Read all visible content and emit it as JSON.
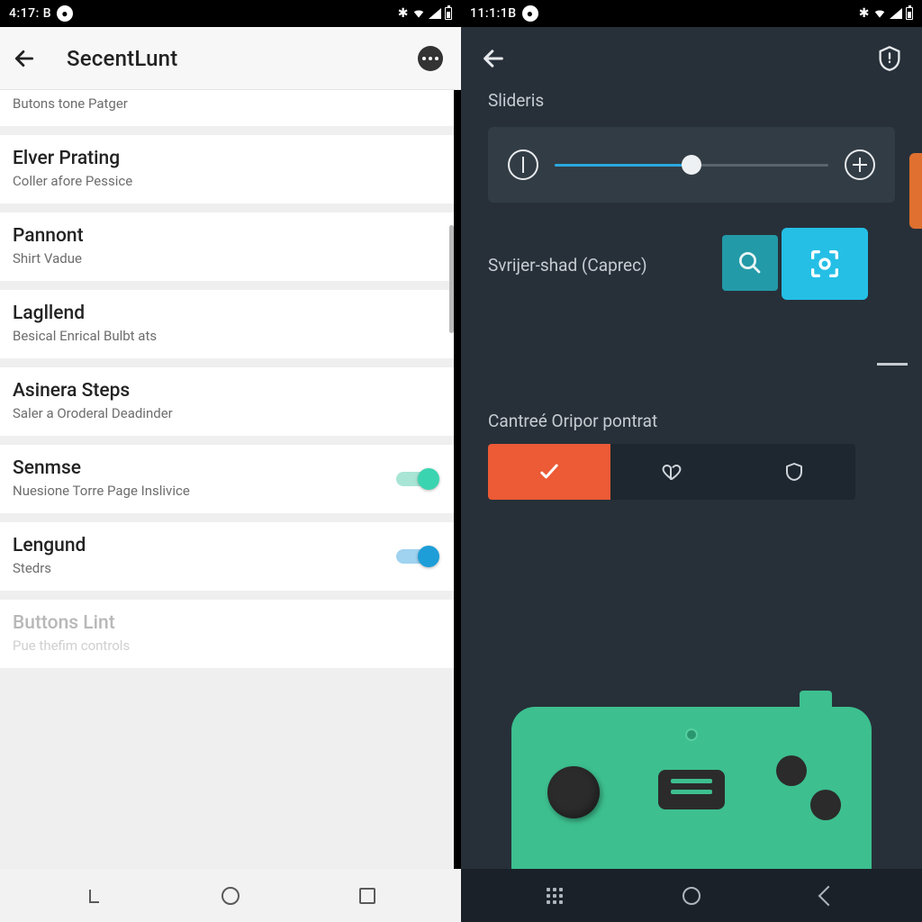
{
  "colors": {
    "accent_teal": "#3bd4b0",
    "accent_blue": "#1e9ed8",
    "dark_bg": "#273039",
    "orange": "#ec5a36",
    "green": "#3dbf8f",
    "cyan": "#25bfe6"
  },
  "left": {
    "status_time": "4:17: B",
    "title": "SecentLunt",
    "rows": [
      {
        "title": "",
        "subtitle": "Butons tone Patger"
      },
      {
        "title": "Elver Prating",
        "subtitle": "Coller afore Pessice"
      },
      {
        "title": "Pannont",
        "subtitle": "Shirt Vadue"
      },
      {
        "title": "Lagllend",
        "subtitle": "Besical Enrical Bulbt ats"
      },
      {
        "title": "Asinera Steps",
        "subtitle": "Saler a Oroderal Deadinder"
      },
      {
        "title": "Senmse",
        "subtitle": "Nuesione Torre Page Inslivice",
        "toggle": "teal"
      },
      {
        "title": "Lengund",
        "subtitle": "Stedrs",
        "toggle": "blue"
      },
      {
        "title": "Buttons Lint",
        "subtitle": "Pue thefim controls",
        "faded": true
      }
    ]
  },
  "right": {
    "status_time": "11:1:1B",
    "section_slider": "Slideris",
    "slider_value_pct": 50,
    "section_switch": "Svrijer-shad (Caprec)",
    "section_segment": "Cantreé Oripor pontrat"
  }
}
